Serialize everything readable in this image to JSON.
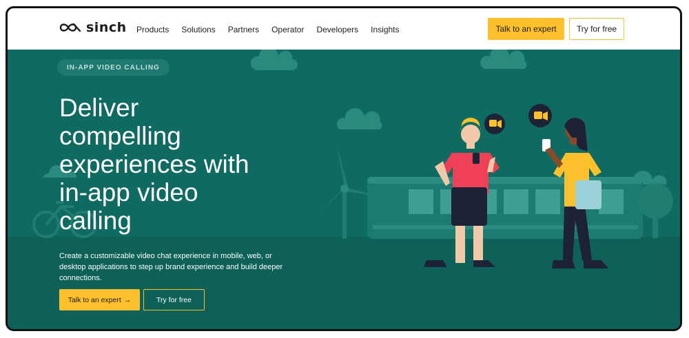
{
  "brand": {
    "name": "sinch"
  },
  "nav": {
    "items": [
      {
        "label": "Products"
      },
      {
        "label": "Solutions"
      },
      {
        "label": "Partners"
      },
      {
        "label": "Operator"
      },
      {
        "label": "Developers"
      },
      {
        "label": "Insights"
      }
    ],
    "cta_label": "Talk to an expert",
    "try_label": "Try for free"
  },
  "hero": {
    "eyebrow": "IN-APP VIDEO CALLING",
    "headline_lines": [
      "Deliver",
      "compelling",
      "experiences with",
      "in-app video",
      "calling"
    ],
    "subtext": "Create a customizable video chat experience in mobile, web, or desktop applications to step up brand experience and build deeper connections.",
    "cta_label": "Talk to an expert",
    "cta_arrow": "→",
    "try_label": "Try for free"
  },
  "colors": {
    "hero_bg": "#0f6b62",
    "accent_yellow": "#fcc02c",
    "nav_bg": "#ffffff"
  },
  "icons": [
    "sinch-logo-icon",
    "arrow-right-icon",
    "video-camera-icon"
  ]
}
